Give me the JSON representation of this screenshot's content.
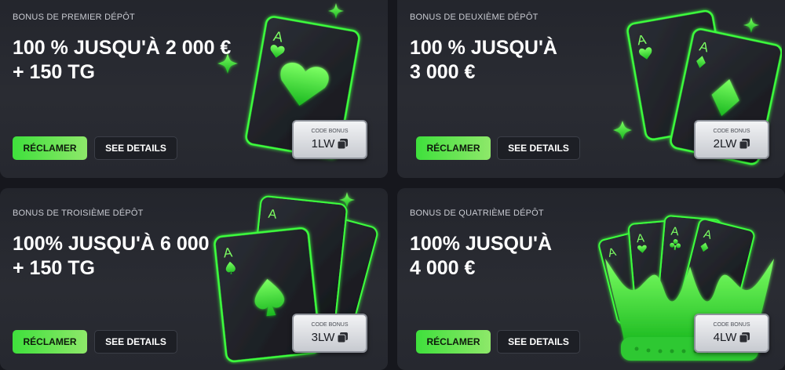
{
  "cards": [
    {
      "eyebrow": "BONUS DE PREMIER DÉPÔT",
      "title": "100 % JUSQU'À 2 000 €\n+ 150 TG",
      "claim_label": "RÉCLAMER",
      "details_label": "SEE DETAILS",
      "code_label": "CODE BONUS",
      "code": "1LW"
    },
    {
      "eyebrow": "BONUS DE DEUXIÈME DÉPÔT",
      "title": "100 % JUSQU'À\n3 000 €",
      "claim_label": "RÉCLAMER",
      "details_label": "SEE DETAILS",
      "code_label": "CODE BONUS",
      "code": "2LW"
    },
    {
      "eyebrow": "BONUS DE TROISIÈME DÉPÔT",
      "title": "100% JUSQU'À 6 000 €\n+ 150 TG",
      "claim_label": "RÉCLAMER",
      "details_label": "SEE DETAILS",
      "code_label": "CODE BONUS",
      "code": "3LW"
    },
    {
      "eyebrow": "BONUS DE QUATRIÈME DÉPÔT",
      "title": "100% JUSQU'À\n4 000 €",
      "claim_label": "RÉCLAMER",
      "details_label": "SEE DETAILS",
      "code_label": "CODE BONUS",
      "code": "4LW"
    }
  ],
  "card_letter": "A",
  "colors": {
    "accent_green": "#3fe03c",
    "card_bg": "#2a2c33",
    "page_bg": "#16171d"
  },
  "icons": [
    "copy-icon",
    "sparkle-icon",
    "heart-suit-icon",
    "diamond-suit-icon",
    "spade-suit-icon",
    "club-suit-icon",
    "crown-icon"
  ]
}
